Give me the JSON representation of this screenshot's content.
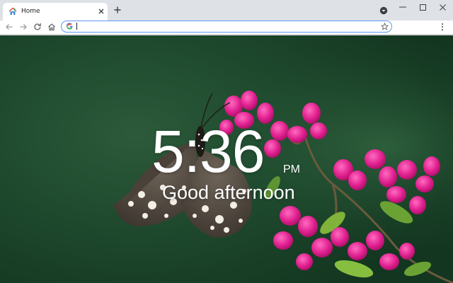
{
  "browser": {
    "tab": {
      "title": "Home",
      "favicon": "house-icon"
    },
    "icons": {
      "new_tab": "plus-icon",
      "close_tab": "close-icon",
      "profile": "profile-circle-icon",
      "minimize": "minimize-icon",
      "maximize": "maximize-icon",
      "close_window": "close-icon",
      "back": "back-arrow-icon",
      "forward": "forward-arrow-icon",
      "reload": "reload-icon",
      "home": "home-icon",
      "search_engine": "google-g-icon",
      "bookmark": "star-icon",
      "menu": "kebab-menu-icon"
    },
    "omnibox": {
      "value": ""
    },
    "colors": {
      "tab_strip": "#dee1e6",
      "toolbar": "#ffffff",
      "omnibox_focus": "#5e97f6"
    }
  },
  "ntp": {
    "time": "5:36",
    "ampm": "PM",
    "greeting": "Good afternoon",
    "background": "butterfly on pink flowers photo"
  }
}
